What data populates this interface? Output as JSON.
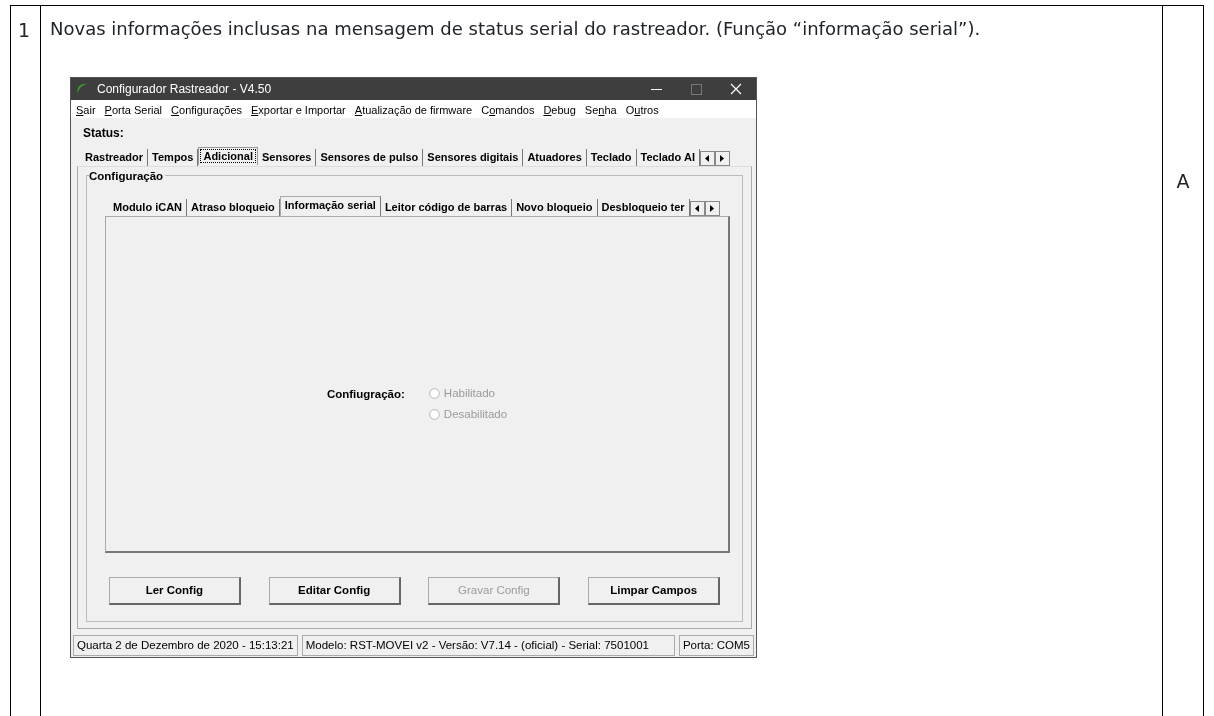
{
  "document": {
    "row_number": "1",
    "description": "Novas informações inclusas na mensagem de status serial do rastreador. (Função “informação serial”).",
    "side_label": "A"
  },
  "window": {
    "title": "Configurador Rastreador - V4.50"
  },
  "menu": [
    {
      "access_key": "S",
      "rest": "air"
    },
    {
      "access_key": "P",
      "rest": "orta Serial"
    },
    {
      "access_key": "C",
      "rest": "onfigurações"
    },
    {
      "access_key": "E",
      "rest": "xportar e Importar"
    },
    {
      "access_key": "A",
      "rest": "tualização de firmware"
    },
    {
      "start": "C",
      "access_key": "o",
      "rest": "mandos"
    },
    {
      "access_key": "D",
      "rest": "ebug"
    },
    {
      "start": "Se",
      "access_key": "n",
      "rest": "ha"
    },
    {
      "start": "O",
      "access_key": "u",
      "rest": "tros"
    }
  ],
  "status_label": "Status:",
  "main_tabs": [
    {
      "label": "Rastreador",
      "selected": false
    },
    {
      "label": "Tempos",
      "selected": false
    },
    {
      "label": "Adicional",
      "selected": true
    },
    {
      "label": "Sensores",
      "selected": false
    },
    {
      "label": "Sensores de pulso",
      "selected": false
    },
    {
      "label": "Sensores digitais",
      "selected": false
    },
    {
      "label": "Atuadores",
      "selected": false
    },
    {
      "label": "Teclado",
      "selected": false
    },
    {
      "label": "Teclado AI",
      "selected": false
    }
  ],
  "group": {
    "title": "Configuração"
  },
  "sub_tabs": [
    {
      "label": "Modulo iCAN",
      "selected": false
    },
    {
      "label": "Atraso bloqueio",
      "selected": false
    },
    {
      "label": "Informação serial",
      "selected": true
    },
    {
      "label": "Leitor código de barras",
      "selected": false
    },
    {
      "label": "Novo bloqueio",
      "selected": false
    },
    {
      "label": "Desbloqueio ter",
      "selected": false
    }
  ],
  "setting": {
    "label": "Confiugração:",
    "options": [
      {
        "label": "Habilitado",
        "checked": false,
        "disabled": true
      },
      {
        "label": "Desabilitado",
        "checked": false,
        "disabled": true
      }
    ]
  },
  "buttons": [
    {
      "label": "Ler Config",
      "disabled": false
    },
    {
      "label": "Editar Config",
      "disabled": false
    },
    {
      "label": "Gravar Config",
      "disabled": true
    },
    {
      "label": "Limpar Campos",
      "disabled": false
    }
  ],
  "status_bar": [
    "Quarta 2 de Dezembro de 2020  -  15:13:21",
    "Modelo: RST-MOVEI v2  -  Versão: V7.14 - (oficial)  -  Serial: 7501001",
    "Porta: COM5"
  ]
}
